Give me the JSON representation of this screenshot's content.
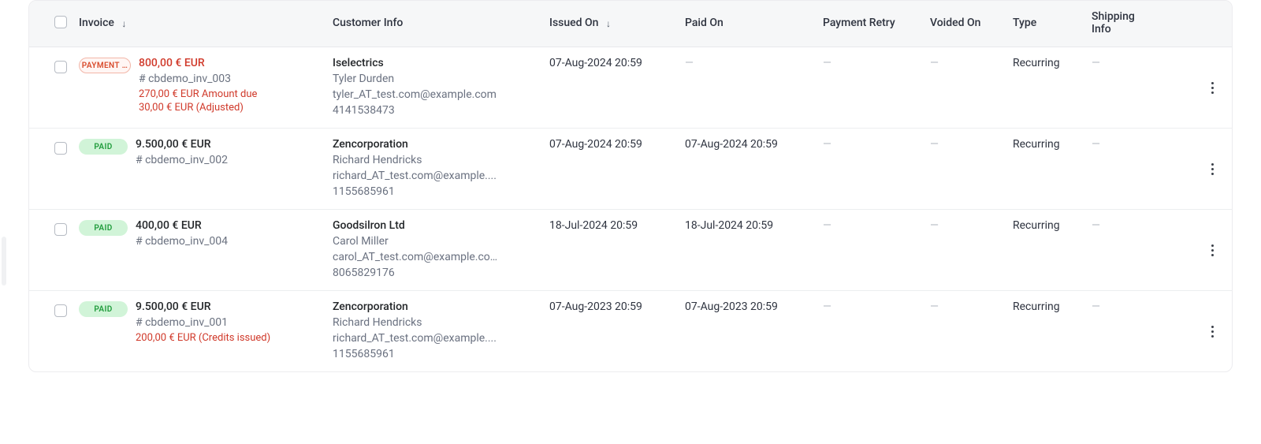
{
  "columns": {
    "invoice": "Invoice",
    "customer": "Customer Info",
    "issued": "Issued On",
    "paid": "Paid On",
    "retry": "Payment Retry",
    "voided": "Voided On",
    "type": "Type",
    "shipping": "Shipping Info"
  },
  "sort_arrow": "↓",
  "dash": "—",
  "rows": [
    {
      "status_label": "PAYMENT …",
      "status_style": "payment",
      "amount": "800,00 € EUR",
      "amount_red": true,
      "invoice_no": "# cbdemo_inv_003",
      "due": "270,00 € EUR Amount due",
      "adjusted": "30,00 € EUR (Adjusted)",
      "credits": "",
      "customer": {
        "company": "Iselectrics",
        "contact": "Tyler Durden",
        "email": "tyler_AT_test.com@example.com",
        "phone": "4141538473"
      },
      "issued": "07-Aug-2024 20:59",
      "paid": "",
      "retry": "",
      "voided": "",
      "type": "Recurring",
      "shipping": ""
    },
    {
      "status_label": "PAID",
      "status_style": "paid",
      "amount": "9.500,00 € EUR",
      "amount_red": false,
      "invoice_no": "# cbdemo_inv_002",
      "due": "",
      "adjusted": "",
      "credits": "",
      "customer": {
        "company": "Zencorporation",
        "contact": "Richard Hendricks",
        "email": "richard_AT_test.com@example....",
        "phone": "1155685961"
      },
      "issued": "07-Aug-2024 20:59",
      "paid": "07-Aug-2024 20:59",
      "retry": "",
      "voided": "",
      "type": "Recurring",
      "shipping": ""
    },
    {
      "status_label": "PAID",
      "status_style": "paid",
      "amount": "400,00 € EUR",
      "amount_red": false,
      "invoice_no": "# cbdemo_inv_004",
      "due": "",
      "adjusted": "",
      "credits": "",
      "customer": {
        "company": "Goodsilron Ltd",
        "contact": "Carol Miller",
        "email": "carol_AT_test.com@example.com",
        "phone": "8065829176"
      },
      "issued": "18-Jul-2024 20:59",
      "paid": "18-Jul-2024 20:59",
      "retry": "",
      "voided": "",
      "type": "Recurring",
      "shipping": ""
    },
    {
      "status_label": "PAID",
      "status_style": "paid",
      "amount": "9.500,00 € EUR",
      "amount_red": false,
      "invoice_no": "# cbdemo_inv_001",
      "due": "",
      "adjusted": "",
      "credits": "200,00 € EUR (Credits issued)",
      "customer": {
        "company": "Zencorporation",
        "contact": "Richard Hendricks",
        "email": "richard_AT_test.com@example....",
        "phone": "1155685961"
      },
      "issued": "07-Aug-2023 20:59",
      "paid": "07-Aug-2023 20:59",
      "retry": "",
      "voided": "",
      "type": "Recurring",
      "shipping": ""
    }
  ]
}
